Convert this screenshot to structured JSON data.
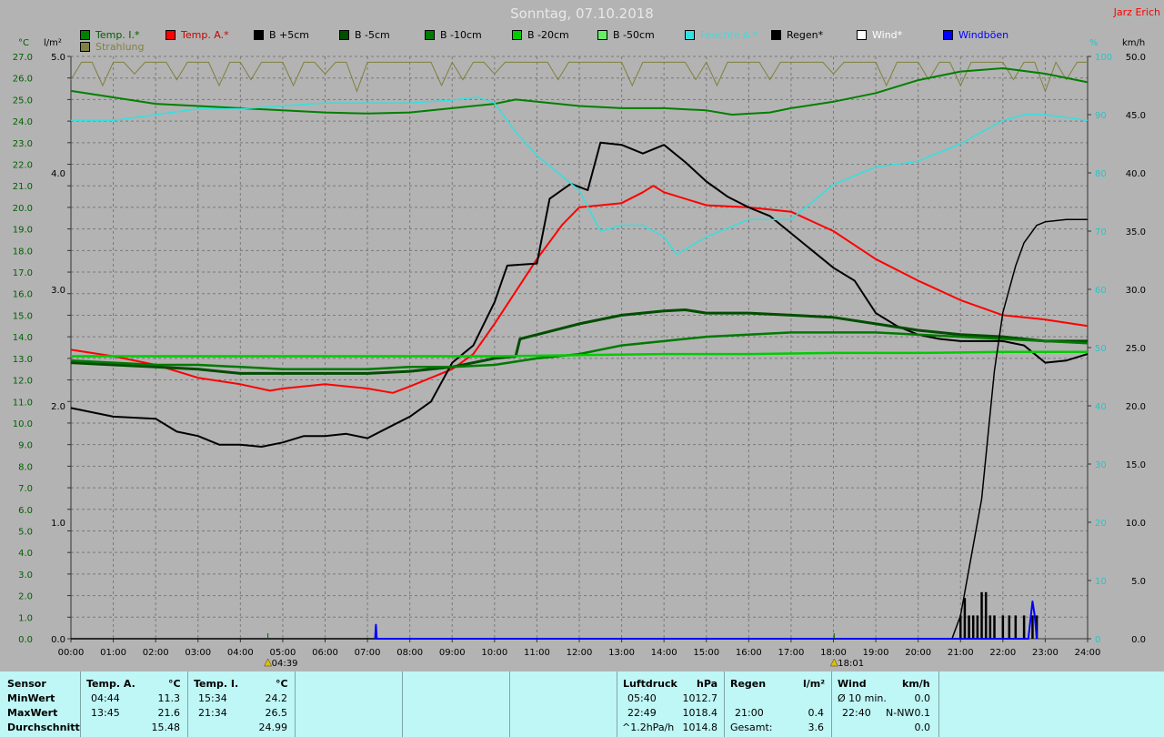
{
  "title": "Sonntag, 07.10.2018",
  "author": "Jarz Erich",
  "legend": [
    {
      "label": "Temp. I.*",
      "color": "#008000"
    },
    {
      "label": "Temp. A.*",
      "color": "#ff0000"
    },
    {
      "label": "B +5cm",
      "color": "#000000"
    },
    {
      "label": "B -5cm",
      "color": "#004d00"
    },
    {
      "label": "B -10cm",
      "color": "#007a00"
    },
    {
      "label": "B -20cm",
      "color": "#00cc00"
    },
    {
      "label": "B -50cm",
      "color": "#66ee66"
    },
    {
      "label": "Feuchte A.*",
      "color": "#33e0e0"
    },
    {
      "label": "Regen*",
      "color": "#000000"
    },
    {
      "label": "Wind*",
      "color": "#ffffff"
    },
    {
      "label": "Windböen",
      "color": "#0000ff"
    },
    {
      "label": "Strahlung",
      "color": "#808040"
    }
  ],
  "units": {
    "temp": "°C",
    "rain": "l/m²",
    "humidity": "%",
    "wind": "km/h"
  },
  "markers": {
    "sunrise": "04:39",
    "sunset": "18:01"
  },
  "chart_data": {
    "type": "line",
    "x_ticks": [
      "00:00",
      "01:00",
      "02:00",
      "03:00",
      "04:00",
      "05:00",
      "06:00",
      "07:00",
      "08:00",
      "09:00",
      "10:00",
      "11:00",
      "12:00",
      "13:00",
      "14:00",
      "15:00",
      "16:00",
      "17:00",
      "18:00",
      "19:00",
      "20:00",
      "21:00",
      "22:00",
      "23:00",
      "24:00"
    ],
    "temp_ticks": [
      "27.0",
      "26.0",
      "25.0",
      "24.0",
      "23.0",
      "22.0",
      "21.0",
      "20.0",
      "19.0",
      "18.0",
      "17.0",
      "16.0",
      "15.0",
      "14.0",
      "13.0",
      "12.0",
      "11.0",
      "10.0",
      "9.0",
      "8.0",
      "7.0",
      "6.0",
      "5.0",
      "4.0",
      "3.0",
      "2.0",
      "1.0",
      "0.0"
    ],
    "rain_ticks": [
      "5.0",
      "4.0",
      "3.0",
      "2.0",
      "1.0",
      "0.0"
    ],
    "hum_ticks": [
      "100",
      "90",
      "80",
      "70",
      "60",
      "50",
      "40",
      "30",
      "20",
      "10",
      "0"
    ],
    "wind_ticks": [
      "50.0",
      "45.0",
      "40.0",
      "35.0",
      "30.0",
      "25.0",
      "20.0",
      "15.0",
      "10.0",
      "5.0",
      "0.0"
    ],
    "ylim_temp": [
      0,
      27
    ],
    "ylim_rain": [
      0,
      5
    ],
    "ylim_hum": [
      0,
      100
    ],
    "ylim_wind": [
      0,
      50
    ],
    "series": [
      {
        "name": "Temp. I.*",
        "axis": "temp",
        "color": "#008000",
        "points": [
          [
            0,
            25.4
          ],
          [
            1,
            25.1
          ],
          [
            2,
            24.8
          ],
          [
            3,
            24.7
          ],
          [
            4,
            24.6
          ],
          [
            5,
            24.5
          ],
          [
            6,
            24.4
          ],
          [
            7,
            24.35
          ],
          [
            8,
            24.4
          ],
          [
            9,
            24.6
          ],
          [
            10,
            24.8
          ],
          [
            10.5,
            25.0
          ],
          [
            11,
            24.9
          ],
          [
            12,
            24.7
          ],
          [
            13,
            24.6
          ],
          [
            14,
            24.6
          ],
          [
            15,
            24.5
          ],
          [
            15.6,
            24.3
          ],
          [
            16.5,
            24.4
          ],
          [
            17,
            24.6
          ],
          [
            18,
            24.9
          ],
          [
            19,
            25.3
          ],
          [
            20,
            25.9
          ],
          [
            21,
            26.3
          ],
          [
            22,
            26.45
          ],
          [
            23,
            26.2
          ],
          [
            24,
            25.8
          ]
        ]
      },
      {
        "name": "Temp. A.*",
        "axis": "temp",
        "color": "#ff0000",
        "points": [
          [
            0,
            13.4
          ],
          [
            1,
            13.1
          ],
          [
            2,
            12.7
          ],
          [
            3,
            12.1
          ],
          [
            4,
            11.8
          ],
          [
            4.7,
            11.5
          ],
          [
            5,
            11.6
          ],
          [
            6,
            11.8
          ],
          [
            7,
            11.6
          ],
          [
            7.6,
            11.4
          ],
          [
            8,
            11.7
          ],
          [
            9,
            12.5
          ],
          [
            9.5,
            13.2
          ],
          [
            10,
            14.6
          ],
          [
            11,
            17.6
          ],
          [
            11.6,
            19.2
          ],
          [
            12,
            20.0
          ],
          [
            12.5,
            20.1
          ],
          [
            13,
            20.2
          ],
          [
            13.5,
            20.7
          ],
          [
            13.75,
            21.0
          ],
          [
            14,
            20.7
          ],
          [
            15,
            20.1
          ],
          [
            16,
            20.0
          ],
          [
            17,
            19.8
          ],
          [
            18,
            18.9
          ],
          [
            19,
            17.6
          ],
          [
            20,
            16.6
          ],
          [
            21,
            15.7
          ],
          [
            22,
            15.0
          ],
          [
            23,
            14.8
          ],
          [
            24,
            14.5
          ]
        ]
      },
      {
        "name": "B +5cm",
        "axis": "temp",
        "color": "#000000",
        "points": [
          [
            0,
            10.7
          ],
          [
            0.5,
            10.5
          ],
          [
            1,
            10.3
          ],
          [
            2,
            10.2
          ],
          [
            2.5,
            9.6
          ],
          [
            3,
            9.4
          ],
          [
            3.5,
            9.0
          ],
          [
            4,
            9.0
          ],
          [
            4.5,
            8.9
          ],
          [
            5,
            9.1
          ],
          [
            5.5,
            9.4
          ],
          [
            6,
            9.4
          ],
          [
            6.5,
            9.5
          ],
          [
            7,
            9.3
          ],
          [
            7.5,
            9.8
          ],
          [
            8,
            10.3
          ],
          [
            8.5,
            11.0
          ],
          [
            9,
            12.8
          ],
          [
            9.5,
            13.6
          ],
          [
            10,
            15.6
          ],
          [
            10.3,
            17.3
          ],
          [
            11,
            17.4
          ],
          [
            11.3,
            20.4
          ],
          [
            11.8,
            21.1
          ],
          [
            12.2,
            20.8
          ],
          [
            12.5,
            23.0
          ],
          [
            13,
            22.9
          ],
          [
            13.5,
            22.5
          ],
          [
            14,
            22.9
          ],
          [
            14.5,
            22.1
          ],
          [
            15,
            21.2
          ],
          [
            15.5,
            20.5
          ],
          [
            16,
            20.0
          ],
          [
            16.5,
            19.6
          ],
          [
            17,
            18.8
          ],
          [
            18,
            17.2
          ],
          [
            18.5,
            16.6
          ],
          [
            19,
            15.1
          ],
          [
            19.5,
            14.5
          ],
          [
            20,
            14.1
          ],
          [
            20.5,
            13.9
          ],
          [
            21,
            13.8
          ],
          [
            22,
            13.8
          ],
          [
            22.5,
            13.6
          ],
          [
            23,
            12.8
          ],
          [
            23.5,
            12.9
          ],
          [
            24,
            13.2
          ]
        ]
      },
      {
        "name": "B -5cm",
        "axis": "temp",
        "color": "#004d00",
        "points": [
          [
            0,
            12.8
          ],
          [
            1,
            12.7
          ],
          [
            2,
            12.6
          ],
          [
            3,
            12.5
          ],
          [
            4,
            12.3
          ],
          [
            5,
            12.3
          ],
          [
            6,
            12.3
          ],
          [
            7,
            12.3
          ],
          [
            8,
            12.4
          ],
          [
            9,
            12.6
          ],
          [
            10,
            13.0
          ],
          [
            10.5,
            13.1
          ],
          [
            10.6,
            13.9
          ],
          [
            11,
            14.1
          ],
          [
            12,
            14.6
          ],
          [
            13,
            15.0
          ],
          [
            14,
            15.2
          ],
          [
            14.5,
            15.25
          ],
          [
            15,
            15.1
          ],
          [
            16,
            15.1
          ],
          [
            17,
            15.0
          ],
          [
            18,
            14.9
          ],
          [
            19,
            14.6
          ],
          [
            20,
            14.3
          ],
          [
            21,
            14.1
          ],
          [
            22,
            14.0
          ],
          [
            23,
            13.8
          ],
          [
            24,
            13.8
          ]
        ]
      },
      {
        "name": "B -10cm",
        "axis": "temp",
        "color": "#007a00",
        "points": [
          [
            0,
            12.9
          ],
          [
            1,
            12.8
          ],
          [
            2,
            12.7
          ],
          [
            3,
            12.7
          ],
          [
            4,
            12.6
          ],
          [
            5,
            12.5
          ],
          [
            6,
            12.5
          ],
          [
            7,
            12.5
          ],
          [
            8,
            12.6
          ],
          [
            9,
            12.6
          ],
          [
            10,
            12.7
          ],
          [
            11,
            13.0
          ],
          [
            12,
            13.2
          ],
          [
            13,
            13.6
          ],
          [
            14,
            13.8
          ],
          [
            15,
            14.0
          ],
          [
            16,
            14.1
          ],
          [
            17,
            14.2
          ],
          [
            18,
            14.2
          ],
          [
            19,
            14.2
          ],
          [
            20,
            14.1
          ],
          [
            21,
            14.0
          ],
          [
            22,
            13.9
          ],
          [
            23,
            13.8
          ],
          [
            24,
            13.7
          ]
        ]
      },
      {
        "name": "B -20cm",
        "axis": "temp",
        "color": "#00cc00",
        "points": [
          [
            0,
            13.1
          ],
          [
            1,
            13.1
          ],
          [
            2,
            13.1
          ],
          [
            4,
            13.1
          ],
          [
            6,
            13.1
          ],
          [
            8,
            13.1
          ],
          [
            10,
            13.1
          ],
          [
            12,
            13.15
          ],
          [
            14,
            13.2
          ],
          [
            16,
            13.2
          ],
          [
            18,
            13.25
          ],
          [
            20,
            13.25
          ],
          [
            22,
            13.3
          ],
          [
            24,
            13.3
          ]
        ]
      },
      {
        "name": "Feuchte A.*",
        "axis": "hum",
        "color": "#33e0e0",
        "points": [
          [
            0,
            89
          ],
          [
            1,
            89
          ],
          [
            2,
            90
          ],
          [
            3,
            91
          ],
          [
            4,
            91
          ],
          [
            5,
            91.5
          ],
          [
            6,
            92
          ],
          [
            7,
            92
          ],
          [
            8,
            92
          ],
          [
            9,
            92.5
          ],
          [
            9.6,
            93
          ],
          [
            10,
            92
          ],
          [
            10.5,
            87
          ],
          [
            11,
            83
          ],
          [
            11.5,
            80
          ],
          [
            12,
            77
          ],
          [
            12.5,
            70
          ],
          [
            13,
            71
          ],
          [
            13.5,
            71
          ],
          [
            14,
            69
          ],
          [
            14.3,
            66
          ],
          [
            15,
            69
          ],
          [
            16,
            72
          ],
          [
            17,
            72
          ],
          [
            17.5,
            75
          ],
          [
            18,
            78
          ],
          [
            19,
            81
          ],
          [
            20,
            82
          ],
          [
            21,
            85
          ],
          [
            21.5,
            87
          ],
          [
            22,
            89
          ],
          [
            22.5,
            90
          ],
          [
            23,
            90
          ],
          [
            24,
            89
          ]
        ]
      },
      {
        "name": "Regen*",
        "axis": "rain",
        "color": "#000000",
        "points": [
          [
            0,
            0
          ],
          [
            20.8,
            0
          ],
          [
            21,
            0.2
          ],
          [
            21.5,
            1.2
          ],
          [
            21.8,
            2.3
          ],
          [
            22,
            2.8
          ],
          [
            22.3,
            3.2
          ],
          [
            22.5,
            3.4
          ],
          [
            22.8,
            3.55
          ],
          [
            23,
            3.58
          ],
          [
            23.5,
            3.6
          ],
          [
            24,
            3.6
          ]
        ]
      },
      {
        "name": "Windböen",
        "axis": "wind",
        "color": "#0000ff",
        "points": [
          [
            7.18,
            0
          ],
          [
            7.2,
            1.2
          ],
          [
            7.22,
            0
          ],
          [
            22.6,
            0
          ],
          [
            22.7,
            3.2
          ],
          [
            22.75,
            2.0
          ],
          [
            22.8,
            0
          ]
        ]
      }
    ],
    "rain_bars": [
      [
        21.0,
        0.2
      ],
      [
        21.1,
        0.35
      ],
      [
        21.2,
        0.2
      ],
      [
        21.3,
        0.2
      ],
      [
        21.4,
        0.2
      ],
      [
        21.5,
        0.4
      ],
      [
        21.6,
        0.4
      ],
      [
        21.7,
        0.2
      ],
      [
        21.8,
        0.2
      ],
      [
        22.0,
        0.2
      ],
      [
        22.15,
        0.2
      ],
      [
        22.3,
        0.2
      ],
      [
        22.5,
        0.2
      ],
      [
        22.7,
        0.2
      ],
      [
        22.8,
        0.2
      ]
    ],
    "radiation": {
      "axis": "hum",
      "baseline": 99,
      "dips": [
        [
          0.1,
          96
        ],
        [
          0.7,
          95
        ],
        [
          1.5,
          97
        ],
        [
          2.5,
          96
        ],
        [
          3.6,
          95
        ],
        [
          4.3,
          96
        ],
        [
          5.2,
          95
        ],
        [
          5.9,
          97
        ],
        [
          6.8,
          94
        ],
        [
          8.7,
          95
        ],
        [
          9.3,
          96
        ],
        [
          10.1,
          97
        ],
        [
          11.5,
          96
        ],
        [
          13.2,
          95
        ],
        [
          14.8,
          96
        ],
        [
          15.3,
          95
        ],
        [
          16.6,
          96
        ],
        [
          17.9,
          97
        ],
        [
          19.3,
          95
        ],
        [
          20.2,
          96
        ],
        [
          21.1,
          95
        ],
        [
          22.2,
          96
        ],
        [
          23.1,
          94
        ],
        [
          23.6,
          96
        ]
      ]
    }
  },
  "stats": {
    "sensor_header": "Sensor",
    "rows": [
      "MinWert",
      "MaxWert",
      "Durchschnitt"
    ],
    "temp_a": {
      "header": "Temp. A.",
      "unit": "°C",
      "min_time": "04:44",
      "min_val": "11.3",
      "max_time": "13:45",
      "max_val": "21.6",
      "avg": "15.48"
    },
    "temp_i": {
      "header": "Temp. I.",
      "unit": "°C",
      "min_time": "15:34",
      "min_val": "24.2",
      "max_time": "21:34",
      "max_val": "26.5",
      "avg": "24.99"
    },
    "pressure": {
      "header": "Luftdruck",
      "unit": "hPa",
      "min_time": "05:40",
      "min_val": "1012.7",
      "max_time": "22:49",
      "max_val": "1018.4",
      "avg_label": "^1.2hPa/h",
      "avg": "1014.8"
    },
    "rain": {
      "header": "Regen",
      "unit": "l/m²",
      "max_time": "21:00",
      "max_val": "0.4",
      "total_label": "Gesamt:",
      "total": "3.6"
    },
    "wind": {
      "header": "Wind",
      "unit": "km/h",
      "avg_label": "Ø 10 min.",
      "avg_val": "0.0",
      "max_time": "22:40",
      "max_dir": "N-NW",
      "max_val": "0.1",
      "gust_val": "0.0"
    }
  }
}
